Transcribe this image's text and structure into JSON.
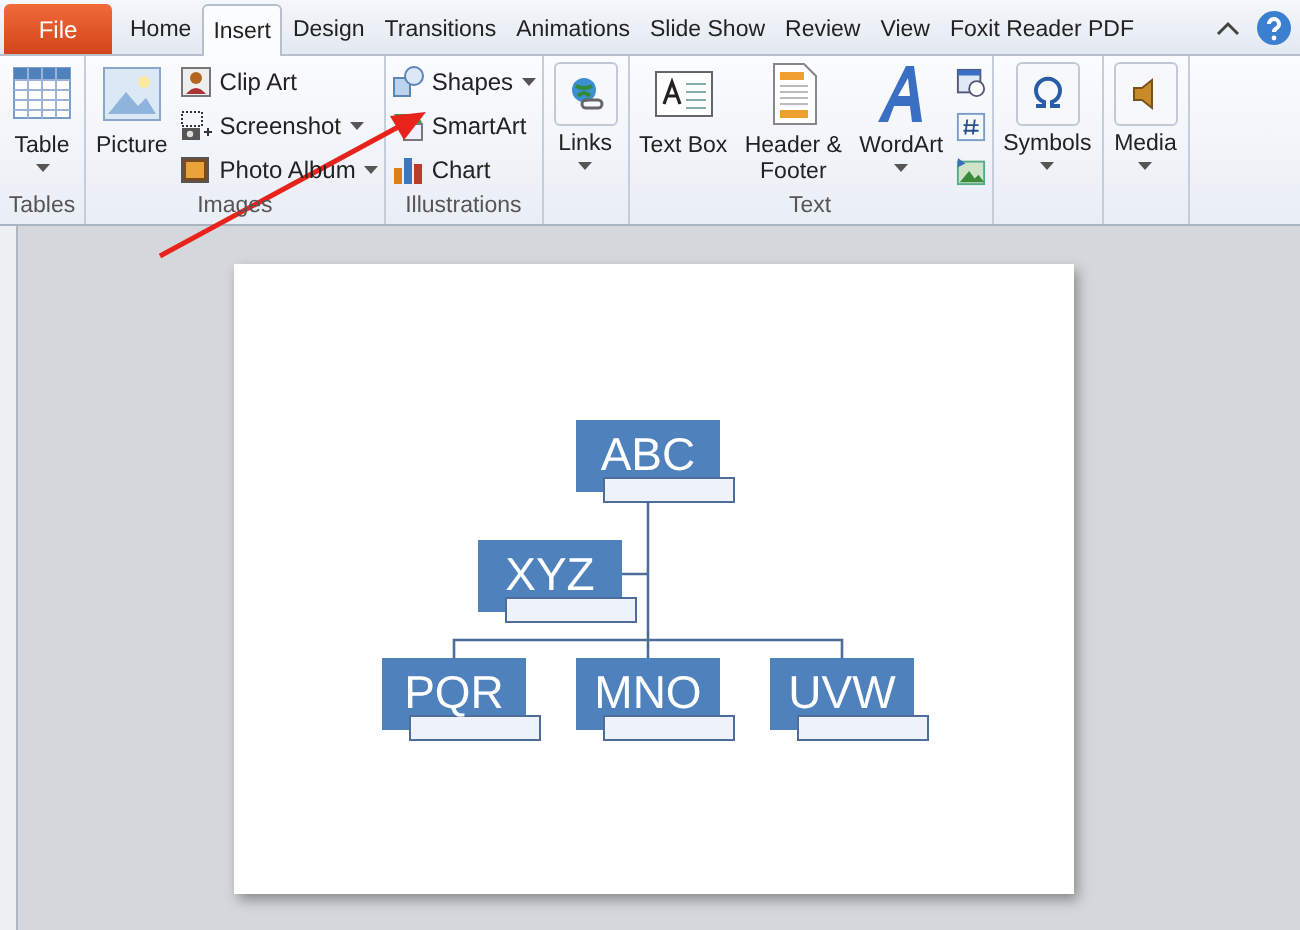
{
  "tabs": [
    {
      "label": "File",
      "kind": "file",
      "selected": false
    },
    {
      "label": "Home",
      "kind": "tab",
      "selected": false
    },
    {
      "label": "Insert",
      "kind": "tab",
      "selected": true
    },
    {
      "label": "Design",
      "kind": "tab",
      "selected": false
    },
    {
      "label": "Transitions",
      "kind": "tab",
      "selected": false
    },
    {
      "label": "Animations",
      "kind": "tab",
      "selected": false
    },
    {
      "label": "Slide Show",
      "kind": "tab",
      "selected": false
    },
    {
      "label": "Review",
      "kind": "tab",
      "selected": false
    },
    {
      "label": "View",
      "kind": "tab",
      "selected": false
    },
    {
      "label": "Foxit Reader PDF",
      "kind": "tab",
      "selected": false
    }
  ],
  "groups": [
    {
      "label": "Tables",
      "columns": [
        [
          {
            "kind": "large",
            "label": "Table",
            "dropdown": true
          }
        ]
      ]
    },
    {
      "label": "Images",
      "columns": [
        [
          {
            "kind": "large",
            "label": "Picture"
          }
        ],
        [
          {
            "kind": "small",
            "label": "Clip Art"
          },
          {
            "kind": "small",
            "label": "Screenshot",
            "dropdown": true
          },
          {
            "kind": "small",
            "label": "Photo Album",
            "dropdown": true
          }
        ]
      ]
    },
    {
      "label": "Illustrations",
      "columns": [
        [
          {
            "kind": "small",
            "label": "Shapes",
            "dropdown": true
          },
          {
            "kind": "small",
            "label": "SmartArt"
          },
          {
            "kind": "small",
            "label": "Chart"
          }
        ]
      ]
    },
    {
      "columns": [
        [
          {
            "kind": "boxed",
            "label": "Links",
            "dropdown": true
          }
        ]
      ]
    },
    {
      "label": "Text",
      "columns": [
        [
          {
            "kind": "large",
            "label": "Text Box"
          }
        ],
        [
          {
            "kind": "large",
            "label": "Header & Footer"
          }
        ],
        [
          {
            "kind": "large",
            "label": "WordArt",
            "dropdown": true
          }
        ],
        [
          {
            "kind": "icon"
          },
          {
            "kind": "icon"
          },
          {
            "kind": "icon"
          }
        ]
      ]
    },
    {
      "columns": [
        [
          {
            "kind": "boxed",
            "label": "Symbols",
            "dropdown": true
          }
        ]
      ]
    },
    {
      "columns": [
        [
          {
            "kind": "boxed",
            "label": "Media",
            "dropdown": true
          }
        ]
      ]
    }
  ],
  "diagram": {
    "nodes": [
      {
        "label": "ABC"
      },
      {
        "label": "XYZ"
      },
      {
        "label": "PQR"
      },
      {
        "label": "MNO"
      },
      {
        "label": "UVW"
      }
    ]
  }
}
